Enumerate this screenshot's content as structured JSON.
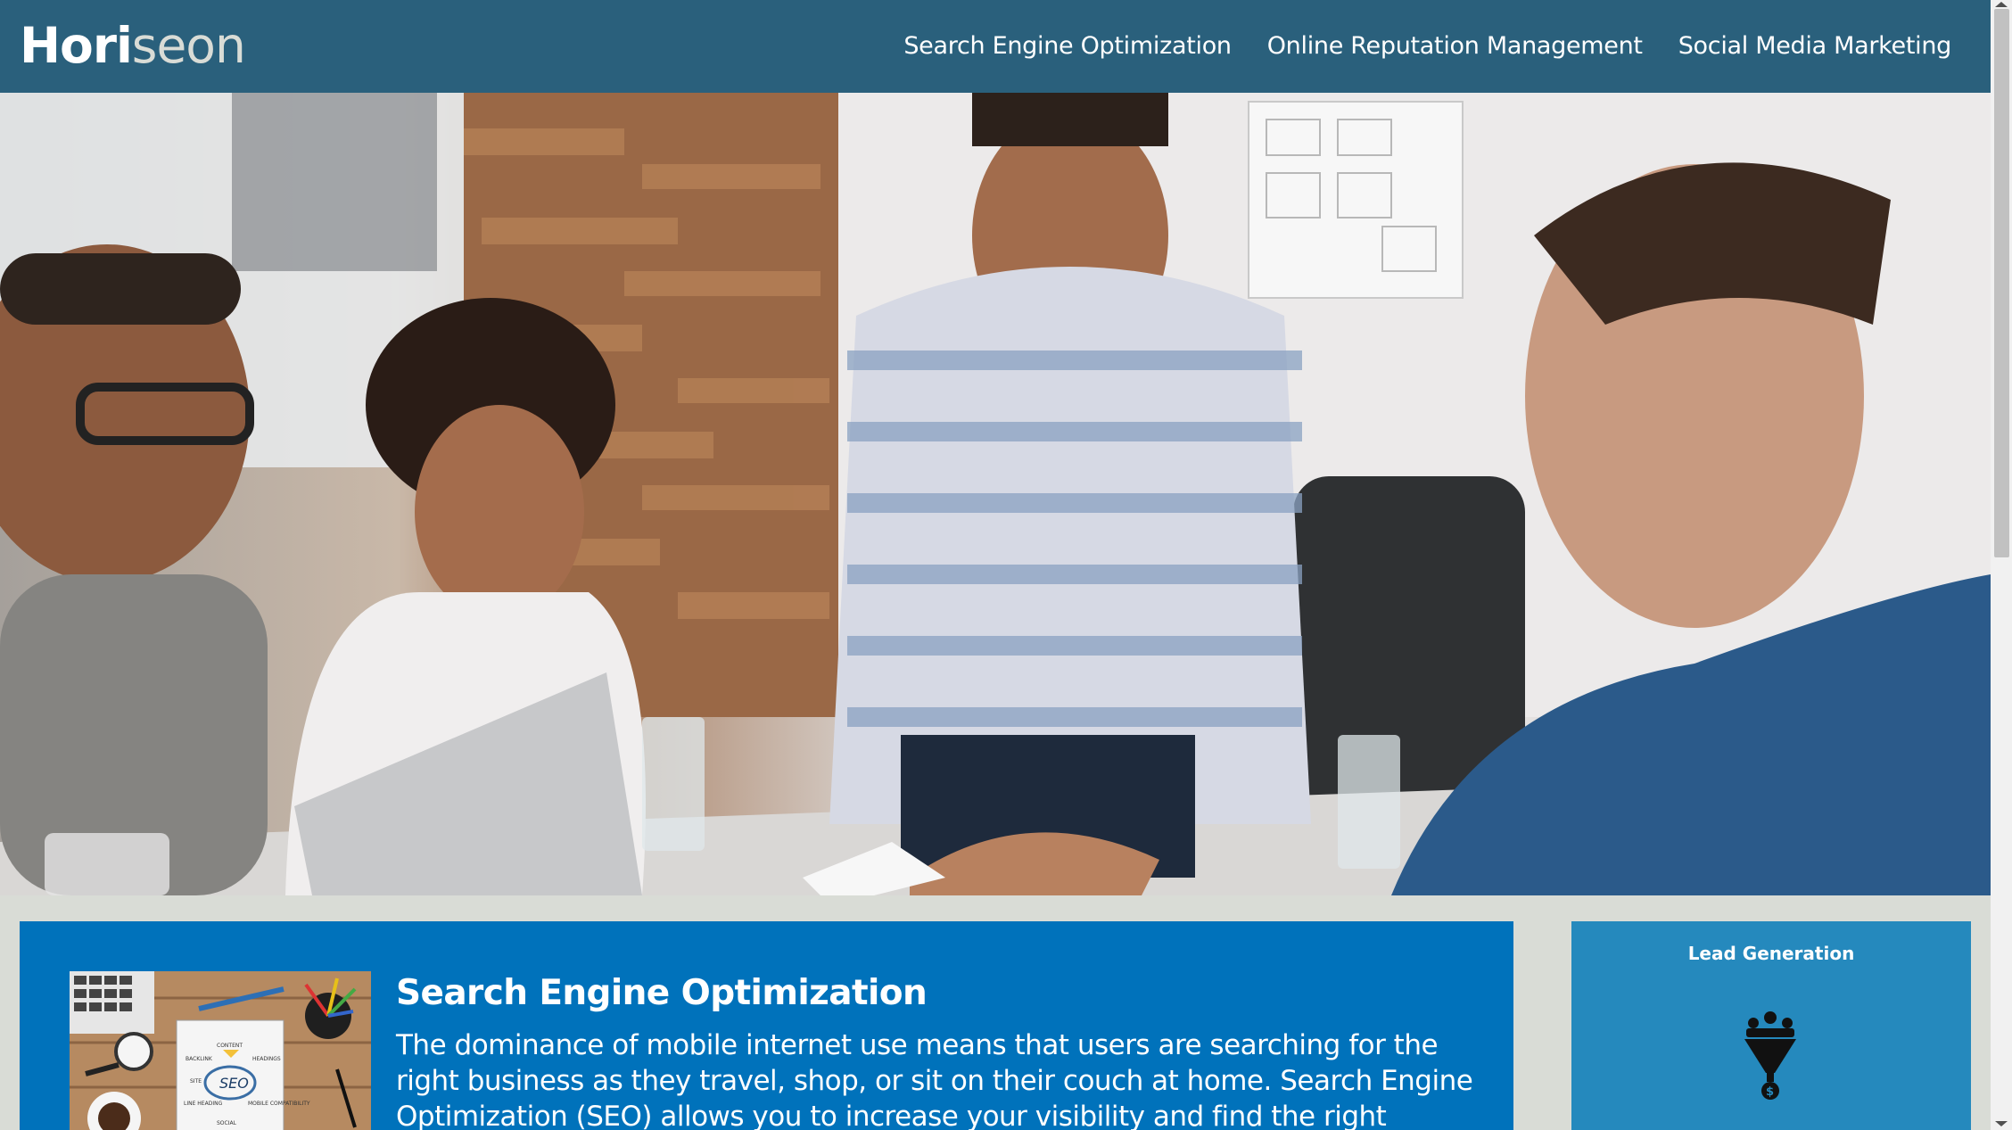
{
  "header": {
    "logo_main": "Hori",
    "logo_accent": "seon",
    "nav": [
      {
        "label": "Search Engine Optimization"
      },
      {
        "label": "Online Reputation Management"
      },
      {
        "label": "Social Media Marketing"
      }
    ]
  },
  "hero": {
    "image": "team-meeting-photo"
  },
  "main": {
    "section_title": "Search Engine Optimization",
    "section_text": "The dominance of mobile internet use means that users are searching for the right business as they travel, shop, or sit on their couch at home. Search Engine Optimization (SEO) allows you to increase your visibility and find the right customers for your",
    "image_alt": "seo-image",
    "seo_image_labels": {
      "center": "SEO",
      "top": "CONTENT",
      "left_top": "BACKLINK",
      "right_top": "HEADINGS",
      "left_mid": "SITE",
      "left_bottom": "LINE HEADING",
      "right_bottom": "MOBILE COMPATIBILITY",
      "bottom": "SOCIAL"
    }
  },
  "benefits": {
    "title": "Lead Generation",
    "icon": "lead-generation-icon",
    "icon_symbol": "$"
  },
  "colors": {
    "header_bg": "#2a607c",
    "main_bg": "#0072bb",
    "benefit_bg": "#2589bd",
    "page_bg": "#d9dcd6"
  }
}
